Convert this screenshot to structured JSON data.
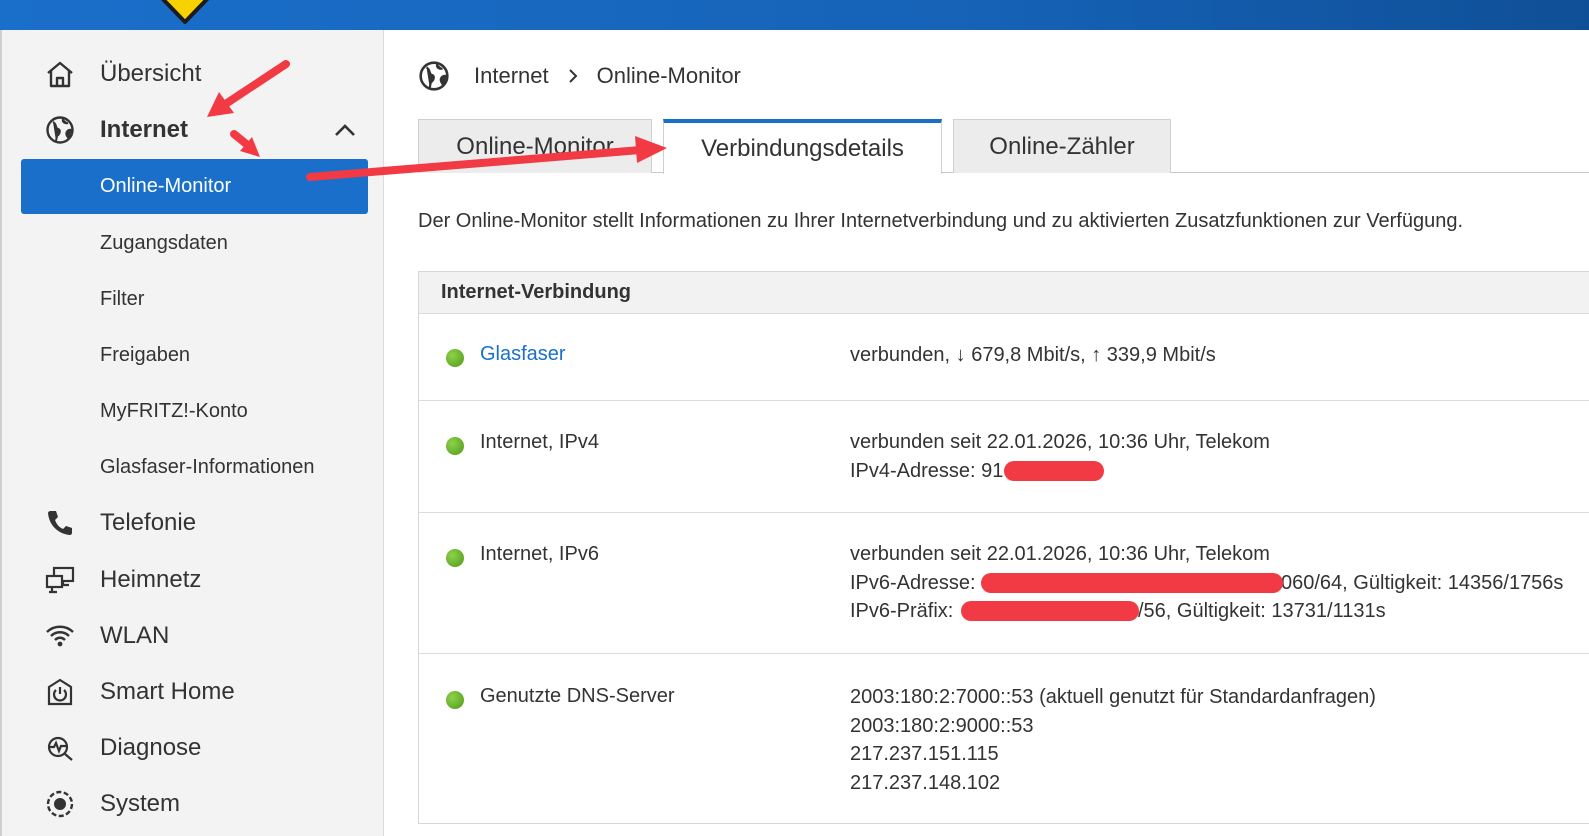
{
  "sidebar": {
    "items": [
      {
        "label": "Übersicht",
        "icon": "home-icon"
      },
      {
        "label": "Internet",
        "icon": "globe-icon"
      },
      {
        "label": "Telefonie",
        "icon": "phone-icon"
      },
      {
        "label": "Heimnetz",
        "icon": "network-icon"
      },
      {
        "label": "WLAN",
        "icon": "wifi-icon"
      },
      {
        "label": "Smart Home",
        "icon": "smart-home-icon"
      },
      {
        "label": "Diagnose",
        "icon": "diagnose-icon"
      },
      {
        "label": "System",
        "icon": "system-icon"
      }
    ],
    "internet_sub": [
      {
        "label": "Online-Monitor",
        "active": true
      },
      {
        "label": "Zugangsdaten"
      },
      {
        "label": "Filter"
      },
      {
        "label": "Freigaben"
      },
      {
        "label": "MyFRITZ!-Konto"
      },
      {
        "label": "Glasfaser-Informationen"
      }
    ]
  },
  "breadcrumb": {
    "section": "Internet",
    "page": "Online-Monitor"
  },
  "tabs": [
    {
      "label": "Online-Monitor"
    },
    {
      "label": "Verbindungsdetails",
      "active": true
    },
    {
      "label": "Online-Zähler"
    }
  ],
  "intro": "Der Online-Monitor stellt Informationen zu Ihrer Internetverbindung und zu aktivierten Zusatzfunktionen zur Verfügung.",
  "panel": {
    "title": "Internet-Verbindung",
    "rows": [
      {
        "label": "Glasfaser",
        "lines": [
          "verbunden, ↓ 679,8 Mbit/s, ↑ 339,9 Mbit/s"
        ]
      },
      {
        "label": "Internet, IPv4",
        "lines": [
          "verbunden seit 22.01.2026, 10:36 Uhr, Telekom",
          "IPv4-Adresse: 91"
        ]
      },
      {
        "label": "Internet, IPv6",
        "lines": [
          "verbunden seit 22.01.2026, 10:36 Uhr, Telekom",
          "IPv6-Adresse: ",
          "IPv6-Präfix: "
        ],
        "ipv6_suffix": "060/64, Gültigkeit: 14356/1756s",
        "prefix_suffix": "/56, Gültigkeit: 13731/1131s"
      },
      {
        "label": "Genutzte DNS-Server",
        "lines": [
          "2003:180:2:7000::53 (aktuell genutzt für Standardanfragen)",
          "2003:180:2:9000::53",
          "217.237.151.115",
          "217.237.148.102"
        ]
      }
    ]
  },
  "colors": {
    "accent": "#1a6fca",
    "status_ok": "#5aab1e",
    "annotation": "#f23a44"
  }
}
